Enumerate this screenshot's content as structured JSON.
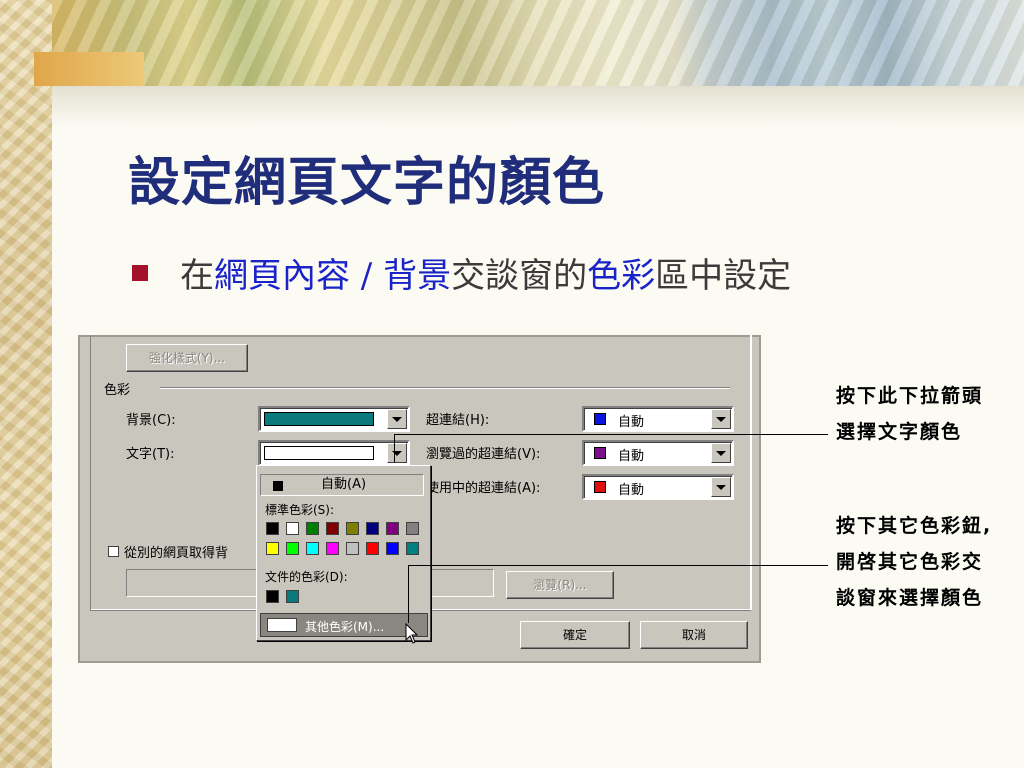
{
  "slide": {
    "title": "設定網頁文字的顏色",
    "bullet": {
      "p1": "在",
      "p2": "網頁內容 / 背景",
      "p3": "交談窗的",
      "p4": "色彩",
      "p5": "區中設定"
    }
  },
  "dialog": {
    "enhance_button": "強化樣式(Y)...",
    "color_group": "色彩",
    "background_label": "背景(C):",
    "text_label": "文字(T):",
    "background_color": "#0b7a7c",
    "text_color": "#ffffff",
    "hyperlink_label": "超連結(H):",
    "visited_label": "瀏覽過的超連結(V):",
    "active_label": "使用中的超連結(A):",
    "hyperlink_value": "自動",
    "visited_value": "自動",
    "active_value": "自動",
    "hyperlink_color": "#0a14e0",
    "visited_color": "#7a0f8a",
    "active_color": "#e01010",
    "checkbox_label": "從別的網頁取得背",
    "browse_button": "瀏覽(R)...",
    "ok_button": "確定",
    "cancel_button": "取消"
  },
  "picker": {
    "auto_label": "自動(A)",
    "standard_label": "標準色彩(S):",
    "standard_colors": [
      "#000000",
      "#ffffff",
      "#008000",
      "#800000",
      "#808000",
      "#000080",
      "#800080",
      "#808080",
      "#ffff00",
      "#00ff00",
      "#00ffff",
      "#ff00ff",
      "#c0c0c0",
      "#ff0000",
      "#0000ff",
      "#008080"
    ],
    "document_label": "文件的色彩(D):",
    "document_colors": [
      "#000000",
      "#0b7a7c"
    ],
    "more_colors": "其他色彩(M)..."
  },
  "callouts": {
    "top_line1": "按下此下拉箭頭",
    "top_line2": "選擇文字顏色",
    "bottom_line1": "按下其它色彩鈕,",
    "bottom_line2": "開啓其它色彩交",
    "bottom_line3": "談窗來選擇顏色"
  }
}
